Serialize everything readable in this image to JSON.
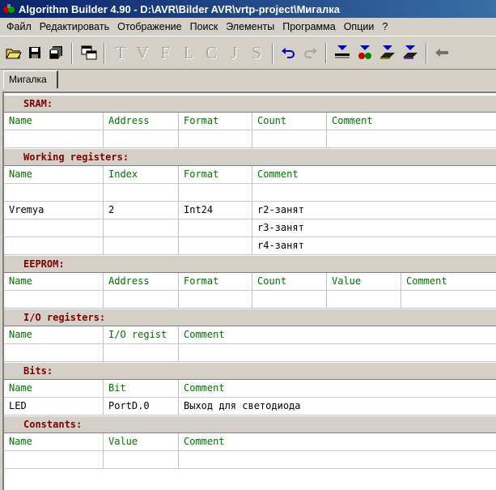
{
  "window": {
    "title": "Algorithm Builder 4.90 - D:\\AVR\\Bilder AVR\\vrtp-project\\Мигалка"
  },
  "menu": [
    "Файл",
    "Редактировать",
    "Отображение",
    "Поиск",
    "Элементы",
    "Программа",
    "Опции",
    "?"
  ],
  "toolbar": {
    "icons": [
      "open-folder-icon",
      "save-icon",
      "save-all-icon",
      "copy-window-icon",
      "undo-icon",
      "redo-icon",
      "compile-icon",
      "run-icon",
      "program-chip-icon",
      "program-chip-write-icon",
      "back-arrow-icon"
    ],
    "letters": [
      "T",
      "V",
      "F",
      "L",
      "C",
      "J",
      "S"
    ],
    "colors": {
      "blue": "#0000c0",
      "red": "#c00000",
      "green": "#008000",
      "disabled": "#aaa8a2"
    }
  },
  "tab": {
    "label": "Мигалка"
  },
  "sections": {
    "sram": {
      "title": "SRAM:",
      "columns": [
        "Name",
        "Address",
        "Format",
        "Count",
        "Comment"
      ]
    },
    "working": {
      "title": "Working registers:",
      "columns": [
        "Name",
        "Index",
        "Format",
        "Comment"
      ],
      "rows": [
        [
          "",
          "",
          "",
          ""
        ],
        [
          "Vremya",
          "2",
          "Int24",
          "r2-занят"
        ],
        [
          "",
          "",
          "",
          "r3-занят"
        ],
        [
          "",
          "",
          "",
          "r4-занят"
        ]
      ]
    },
    "eeprom": {
      "title": "EEPROM:",
      "columns": [
        "Name",
        "Address",
        "Format",
        "Count",
        "Value",
        "Comment"
      ]
    },
    "io": {
      "title": "I/O registers:",
      "columns": [
        "Name",
        "I/O regist",
        "Comment"
      ]
    },
    "bits": {
      "title": "Bits:",
      "columns": [
        "Name",
        "Bit",
        "Comment"
      ],
      "rows": [
        [
          "LED",
          "PortD.0",
          "Выход для светодиода"
        ]
      ]
    },
    "constants": {
      "title": "Constants:",
      "columns": [
        "Name",
        "Value",
        "Comment"
      ]
    }
  }
}
